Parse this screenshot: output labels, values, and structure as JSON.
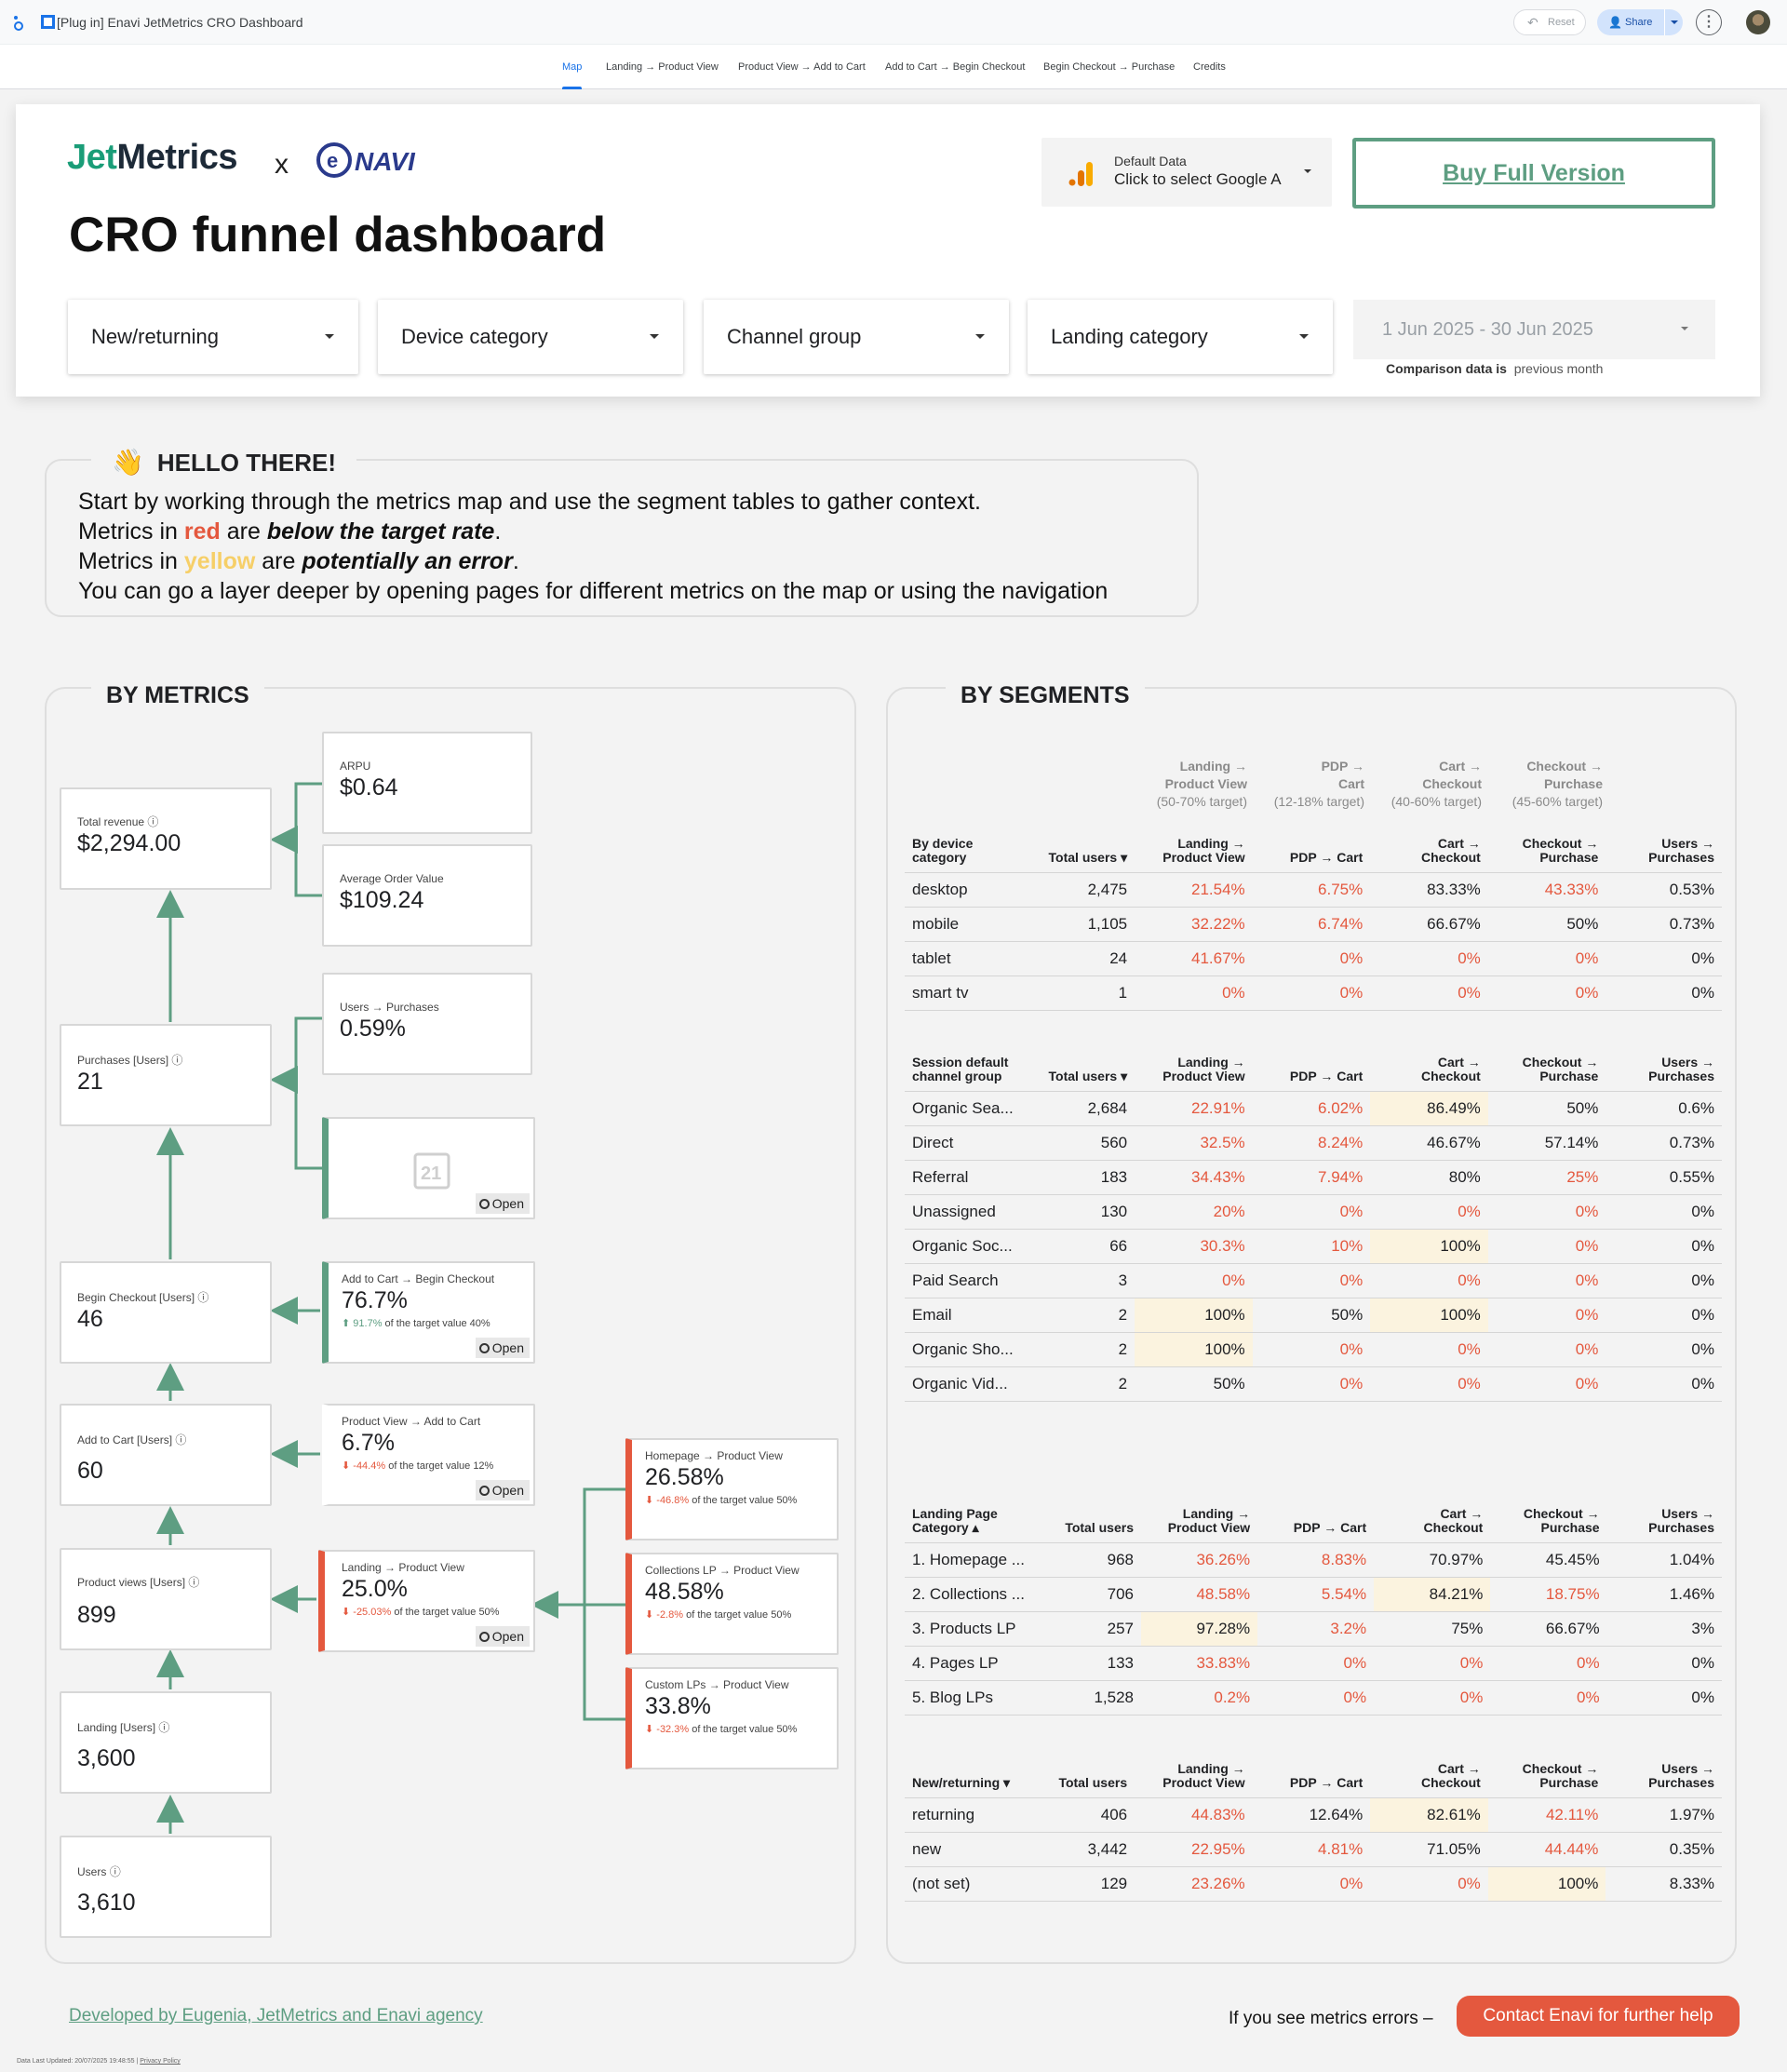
{
  "app": {
    "title": "[Plug in] Enavi JetMetrics CRO Dashboard",
    "reset_label": "Reset",
    "share_label": "Share"
  },
  "nav": {
    "tabs": [
      {
        "label": "Map"
      },
      {
        "label": "Landing → Product View"
      },
      {
        "label": "Product View → Add to Cart"
      },
      {
        "label": "Add to Cart → Begin Checkout"
      },
      {
        "label": "Begin Checkout → Purchase"
      },
      {
        "label": "Credits"
      }
    ]
  },
  "header": {
    "brand_jet": "Jet",
    "brand_metrics": "Metrics",
    "brand_x": "x",
    "brand_navi": "NAVI",
    "title": "CRO funnel dashboard",
    "data_source_label": "Default Data",
    "data_source_value": "Click to select Google A",
    "buy_label": "Buy Full Version",
    "filters": [
      "New/returning",
      "Device category",
      "Channel group",
      "Landing category"
    ],
    "date_range": "1 Jun 2025 - 30 Jun 2025",
    "comparison_label": "Comparison data is",
    "comparison_value": "previous month"
  },
  "hello": {
    "title": "HELLO THERE!",
    "line1": "Start by working through the metrics map and use the segment tables to gather context.",
    "line2_a": "Metrics in ",
    "line2_red": "red",
    "line2_b": " are ",
    "line2_em": "below the target rate",
    "line2_c": ".",
    "line3_a": "Metrics in ",
    "line3_yellow": "yellow",
    "line3_b": " are ",
    "line3_em": "potentially an error",
    "line3_c": ".",
    "line4": "You can go a layer deeper by opening pages for different metrics on the map or using the navigation"
  },
  "metrics": {
    "title": "BY METRICS",
    "open_label": "Open",
    "total_revenue": {
      "label": "Total revenue",
      "value": "$2,294.00"
    },
    "arpu": {
      "label": "ARPU",
      "value": "$0.64"
    },
    "aov": {
      "label": "Average Order Value",
      "value": "$109.24"
    },
    "users_purchases": {
      "label": "Users → Purchases",
      "value": "0.59%"
    },
    "purchases": {
      "label": "Purchases [Users]",
      "value": "21"
    },
    "begin_checkout": {
      "label": "Begin Checkout [Users]",
      "value": "46"
    },
    "atc_bc": {
      "label": "Add to Cart → Begin Checkout",
      "value": "76.7%",
      "delta": "91.7%",
      "delta_text": "of the target value 40%"
    },
    "add_to_cart": {
      "label": "Add to Cart [Users]",
      "value": "60"
    },
    "pv_atc": {
      "label": "Product View → Add to Cart",
      "value": "6.7%",
      "delta": "-44.4%",
      "delta_text": "of the target value 12%"
    },
    "product_views": {
      "label": "Product views [Users]",
      "value": "899"
    },
    "landing_pv": {
      "label": "Landing → Product View",
      "value": "25.0%",
      "delta": "-25.03%",
      "delta_text": "of the target value 50%"
    },
    "landing": {
      "label": "Landing [Users]",
      "value": "3,600"
    },
    "users": {
      "label": "Users",
      "value": "3,610"
    },
    "hp_pv": {
      "label": "Homepage → Product View",
      "value": "26.58%",
      "delta": "-46.8%",
      "delta_text": "of the target value 50%"
    },
    "col_pv": {
      "label": "Collections LP → Product View",
      "value": "48.58%",
      "delta": "-2.8%",
      "delta_text": "of the target value 50%"
    },
    "custom_pv": {
      "label": "Custom LPs → Product View",
      "value": "33.8%",
      "delta": "-32.3%",
      "delta_text": "of the target value 50%"
    }
  },
  "segments": {
    "title": "BY SEGMENTS",
    "targets": [
      {
        "a": "Landing →",
        "b": "Product View",
        "c": "(50-70% target)"
      },
      {
        "a": "PDP →",
        "b": "Cart",
        "c": "(12-18% target)"
      },
      {
        "a": "Cart →",
        "b": "Checkout",
        "c": "(40-60% target)"
      },
      {
        "a": "Checkout →",
        "b": "Purchase",
        "c": "(45-60% target)"
      }
    ],
    "tables": [
      {
        "headers": [
          "By device category",
          "Total users ▾",
          "Landing → Product View",
          "PDP → Cart",
          "Cart → Checkout",
          "Checkout → Purchase",
          "Users → Purchases"
        ],
        "rows": [
          [
            {
              "v": "desktop"
            },
            {
              "v": "2,475"
            },
            {
              "v": "21.54%",
              "s": "r"
            },
            {
              "v": "6.75%",
              "s": "r"
            },
            {
              "v": "83.33%"
            },
            {
              "v": "43.33%",
              "s": "r"
            },
            {
              "v": "0.53%"
            }
          ],
          [
            {
              "v": "mobile"
            },
            {
              "v": "1,105"
            },
            {
              "v": "32.22%",
              "s": "r"
            },
            {
              "v": "6.74%",
              "s": "r"
            },
            {
              "v": "66.67%"
            },
            {
              "v": "50%"
            },
            {
              "v": "0.73%"
            }
          ],
          [
            {
              "v": "tablet"
            },
            {
              "v": "24"
            },
            {
              "v": "41.67%",
              "s": "r"
            },
            {
              "v": "0%",
              "s": "r"
            },
            {
              "v": "0%",
              "s": "r"
            },
            {
              "v": "0%",
              "s": "r"
            },
            {
              "v": "0%"
            }
          ],
          [
            {
              "v": "smart tv"
            },
            {
              "v": "1"
            },
            {
              "v": "0%",
              "s": "r"
            },
            {
              "v": "0%",
              "s": "r"
            },
            {
              "v": "0%",
              "s": "r"
            },
            {
              "v": "0%",
              "s": "r"
            },
            {
              "v": "0%"
            }
          ]
        ]
      },
      {
        "headers": [
          "Session default channel group",
          "Total users ▾",
          "Landing → Product View",
          "PDP → Cart",
          "Cart → Checkout",
          "Checkout → Purchase",
          "Users → Purchases"
        ],
        "rows": [
          [
            {
              "v": "Organic Sea..."
            },
            {
              "v": "2,684"
            },
            {
              "v": "22.91%",
              "s": "r"
            },
            {
              "v": "6.02%",
              "s": "r"
            },
            {
              "v": "86.49%",
              "s": "y"
            },
            {
              "v": "50%"
            },
            {
              "v": "0.6%"
            }
          ],
          [
            {
              "v": "Direct"
            },
            {
              "v": "560"
            },
            {
              "v": "32.5%",
              "s": "r"
            },
            {
              "v": "8.24%",
              "s": "r"
            },
            {
              "v": "46.67%"
            },
            {
              "v": "57.14%"
            },
            {
              "v": "0.73%"
            }
          ],
          [
            {
              "v": "Referral"
            },
            {
              "v": "183"
            },
            {
              "v": "34.43%",
              "s": "r"
            },
            {
              "v": "7.94%",
              "s": "r"
            },
            {
              "v": "80%"
            },
            {
              "v": "25%",
              "s": "r"
            },
            {
              "v": "0.55%"
            }
          ],
          [
            {
              "v": "Unassigned"
            },
            {
              "v": "130"
            },
            {
              "v": "20%",
              "s": "r"
            },
            {
              "v": "0%",
              "s": "r"
            },
            {
              "v": "0%",
              "s": "r"
            },
            {
              "v": "0%",
              "s": "r"
            },
            {
              "v": "0%"
            }
          ],
          [
            {
              "v": "Organic Soc..."
            },
            {
              "v": "66"
            },
            {
              "v": "30.3%",
              "s": "r"
            },
            {
              "v": "10%",
              "s": "r"
            },
            {
              "v": "100%",
              "s": "y"
            },
            {
              "v": "0%",
              "s": "r"
            },
            {
              "v": "0%"
            }
          ],
          [
            {
              "v": "Paid Search"
            },
            {
              "v": "3"
            },
            {
              "v": "0%",
              "s": "r"
            },
            {
              "v": "0%",
              "s": "r"
            },
            {
              "v": "0%",
              "s": "r"
            },
            {
              "v": "0%",
              "s": "r"
            },
            {
              "v": "0%"
            }
          ],
          [
            {
              "v": "Email"
            },
            {
              "v": "2"
            },
            {
              "v": "100%",
              "s": "y"
            },
            {
              "v": "50%"
            },
            {
              "v": "100%",
              "s": "y"
            },
            {
              "v": "0%",
              "s": "r"
            },
            {
              "v": "0%"
            }
          ],
          [
            {
              "v": "Organic Sho..."
            },
            {
              "v": "2"
            },
            {
              "v": "100%",
              "s": "y"
            },
            {
              "v": "0%",
              "s": "r"
            },
            {
              "v": "0%",
              "s": "r"
            },
            {
              "v": "0%",
              "s": "r"
            },
            {
              "v": "0%"
            }
          ],
          [
            {
              "v": "Organic Vid..."
            },
            {
              "v": "2"
            },
            {
              "v": "50%"
            },
            {
              "v": "0%",
              "s": "r"
            },
            {
              "v": "0%",
              "s": "r"
            },
            {
              "v": "0%",
              "s": "r"
            },
            {
              "v": "0%"
            }
          ]
        ]
      },
      {
        "headers": [
          "Landing Page Category ▴",
          "Total users",
          "Landing → Product View",
          "PDP → Cart",
          "Cart → Checkout",
          "Checkout → Purchase",
          "Users → Purchases"
        ],
        "rows": [
          [
            {
              "v": "1. Homepage ..."
            },
            {
              "v": "968"
            },
            {
              "v": "36.26%",
              "s": "r"
            },
            {
              "v": "8.83%",
              "s": "r"
            },
            {
              "v": "70.97%"
            },
            {
              "v": "45.45%"
            },
            {
              "v": "1.04%"
            }
          ],
          [
            {
              "v": "2. Collections ..."
            },
            {
              "v": "706"
            },
            {
              "v": "48.58%",
              "s": "r"
            },
            {
              "v": "5.54%",
              "s": "r"
            },
            {
              "v": "84.21%",
              "s": "y"
            },
            {
              "v": "18.75%",
              "s": "r"
            },
            {
              "v": "1.46%"
            }
          ],
          [
            {
              "v": "3. Products LP"
            },
            {
              "v": "257"
            },
            {
              "v": "97.28%",
              "s": "y"
            },
            {
              "v": "3.2%",
              "s": "r"
            },
            {
              "v": "75%"
            },
            {
              "v": "66.67%"
            },
            {
              "v": "3%"
            }
          ],
          [
            {
              "v": "4. Pages LP"
            },
            {
              "v": "133"
            },
            {
              "v": "33.83%",
              "s": "r"
            },
            {
              "v": "0%",
              "s": "r"
            },
            {
              "v": "0%",
              "s": "r"
            },
            {
              "v": "0%",
              "s": "r"
            },
            {
              "v": "0%"
            }
          ],
          [
            {
              "v": "5. Blog LPs"
            },
            {
              "v": "1,528"
            },
            {
              "v": "0.2%",
              "s": "r"
            },
            {
              "v": "0%",
              "s": "r"
            },
            {
              "v": "0%",
              "s": "r"
            },
            {
              "v": "0%",
              "s": "r"
            },
            {
              "v": "0%"
            }
          ]
        ]
      },
      {
        "headers": [
          "New/returning ▾",
          "Total users",
          "Landing → Product View",
          "PDP → Cart",
          "Cart → Checkout",
          "Checkout → Purchase",
          "Users → Purchases"
        ],
        "rows": [
          [
            {
              "v": "returning"
            },
            {
              "v": "406"
            },
            {
              "v": "44.83%",
              "s": "r"
            },
            {
              "v": "12.64%"
            },
            {
              "v": "82.61%",
              "s": "y"
            },
            {
              "v": "42.11%",
              "s": "r"
            },
            {
              "v": "1.97%"
            }
          ],
          [
            {
              "v": "new"
            },
            {
              "v": "3,442"
            },
            {
              "v": "22.95%",
              "s": "r"
            },
            {
              "v": "4.81%",
              "s": "r"
            },
            {
              "v": "71.05%"
            },
            {
              "v": "44.44%",
              "s": "r"
            },
            {
              "v": "0.35%"
            }
          ],
          [
            {
              "v": "(not set)"
            },
            {
              "v": "129"
            },
            {
              "v": "23.26%",
              "s": "r"
            },
            {
              "v": "0%",
              "s": "r"
            },
            {
              "v": "0%",
              "s": "r"
            },
            {
              "v": "100%",
              "s": "y"
            },
            {
              "v": "8.33%"
            }
          ]
        ]
      }
    ]
  },
  "footer": {
    "developed_by": "Developed by Eugenia, JetMetrics and Enavi agency",
    "errors_text": "If you see metrics errors –",
    "contact_label": "Contact Enavi for further help",
    "last_updated": "Data Last Updated: 20/07/2025 19:48:55",
    "privacy": "Privacy Policy"
  },
  "colors": {
    "accent": "#1a73e8",
    "green": "#5e9e82",
    "red": "#e4583e",
    "yellow": "#fbf3df",
    "brand_green": "#1a9d78"
  }
}
